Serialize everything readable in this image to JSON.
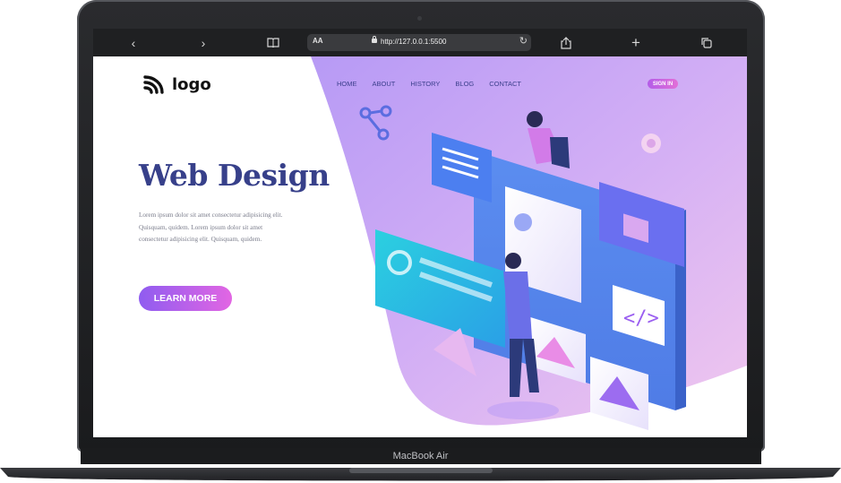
{
  "browser": {
    "text_size_label": "AA",
    "url": "http://127.0.0.1:5500"
  },
  "site": {
    "logo_text": "logo",
    "nav": [
      "HOME",
      "ABOUT",
      "HISTORY",
      "BLOG",
      "CONTACT"
    ],
    "signin_label": "SIGN IN",
    "hero_title": "Web Design",
    "hero_text": "Lorem ipsum dolor sit amet consectetur adipisicing elit. Quisquam, quidem. Lorem ipsum dolor sit amet consectetur adipisicing elit. Quisquam, quidem.",
    "cta_label": "LEARN MORE"
  },
  "device": {
    "label": "MacBook Air"
  },
  "colors": {
    "title": "#37408a",
    "accent_start": "#8f5cf0",
    "accent_end": "#e266e3",
    "bg_purple": "#c8a8f5",
    "bar": "#1f2022"
  }
}
